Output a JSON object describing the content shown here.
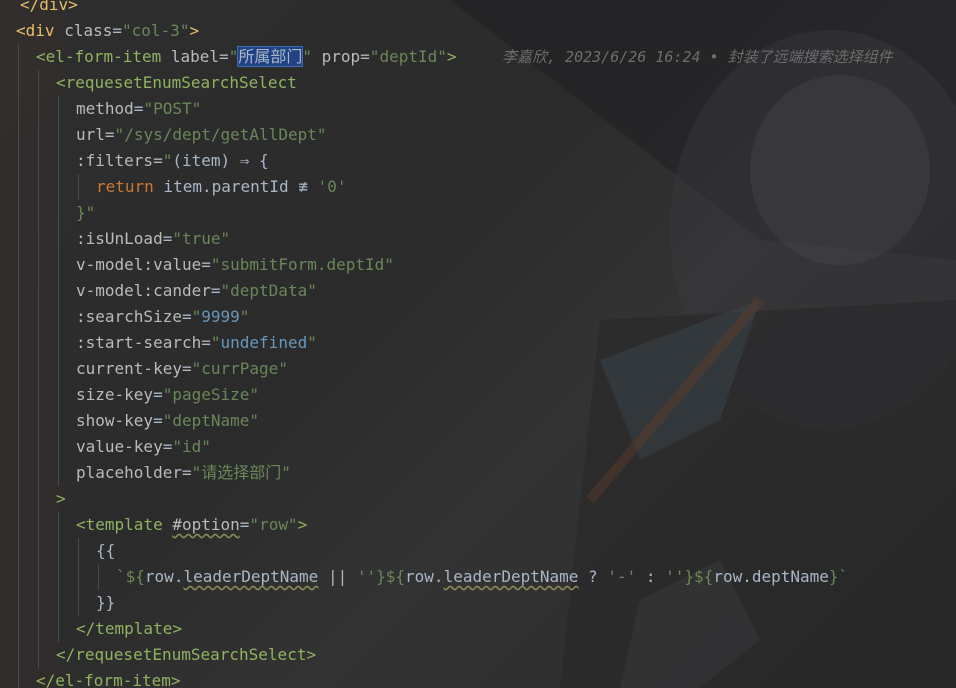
{
  "editor": {
    "line0": {
      "text": "</div>"
    },
    "line1": {
      "tag": "div",
      "attr": "class",
      "value": "col-3"
    },
    "line2": {
      "tag": "el-form-item",
      "attr1": "label",
      "value1": "所属部门",
      "attr2": "prop",
      "value2": "deptId",
      "blame": "李嘉欣, 2023/6/26 16:24 • 封装了远端搜索选择组件"
    },
    "line3": {
      "tag": "requesetEnumSearchSelect"
    },
    "line4": {
      "attr": "method",
      "value": "POST"
    },
    "line5": {
      "attr": "url",
      "value": "/sys/dept/getAllDept"
    },
    "line6": {
      "attr": ":filters",
      "code": "(item) ⇒ {"
    },
    "line7": {
      "kw": "return",
      "expr": "item.parentId",
      "op": "≢",
      "value": "'0'"
    },
    "line8": {
      "text": "}\""
    },
    "line9": {
      "attr": ":isUnLoad",
      "value": "true"
    },
    "line10": {
      "attr": "v-model:value",
      "value": "submitForm.deptId"
    },
    "line11": {
      "attr": "v-model:cander",
      "value": "deptData"
    },
    "line12": {
      "attr": ":searchSize",
      "value": "9999"
    },
    "line13": {
      "attr": ":start-search",
      "value": "undefined"
    },
    "line14": {
      "attr": "current-key",
      "value": "currPage"
    },
    "line15": {
      "attr": "size-key",
      "value": "pageSize"
    },
    "line16": {
      "attr": "show-key",
      "value": "deptName"
    },
    "line17": {
      "attr": "value-key",
      "value": "id"
    },
    "line18": {
      "attr": "placeholder",
      "value": "请选择部门"
    },
    "line19": {
      "text": ">"
    },
    "line20": {
      "tag": "template",
      "attr": "#option",
      "value": "row"
    },
    "line21": {
      "text": "{{"
    },
    "line22": {
      "p1": "`${",
      "v1": "row",
      "v1b": "leaderDeptName",
      "p2": " || ",
      "s1": "''",
      "p3": "}${",
      "v2": "row",
      "v2b": "leaderDeptName",
      "p4": " ? ",
      "s2": "'-'",
      "p5": " : ",
      "s3": "''",
      "p6": "}${",
      "v3": "row",
      "v3b": "deptName",
      "p7": "}`"
    },
    "line23": {
      "text": "}}"
    },
    "line24": {
      "tag": "template"
    },
    "line25": {
      "tag": "requesetEnumSearchSelect"
    },
    "line26": {
      "tag": "el-form-item"
    }
  }
}
